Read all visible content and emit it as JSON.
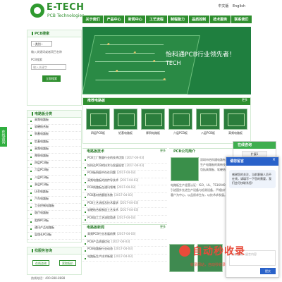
{
  "header": {
    "logo_text": "E-TECH",
    "logo_sub": "PCB Technologies",
    "lang": [
      "中文版",
      "English"
    ]
  },
  "nav": [
    "关于我们",
    "产品中心",
    "新闻中心",
    "工艺流程",
    "制程能力",
    "品质控制",
    "技术服务",
    "联系我们"
  ],
  "banner": {
    "slogan": "怡科通PCB行业领先者！",
    "en": "TECH"
  },
  "search": {
    "title": "PCB搜索",
    "select_value": "--类别--",
    "hint": "输入关键词或者项目名称",
    "label": "PCB搜索",
    "placeholder": "输入关键字",
    "button": "立即搜索"
  },
  "categories": {
    "title": "电路板分类",
    "items": [
      "高频电路板",
      "软硬结合板",
      "铜基电路板",
      "铝基电路板",
      "高频电路板",
      "厚铜电路板",
      "四层PCB板",
      "六层PCB板",
      "八层PCB板",
      "多层PCB板",
      "LED电路板",
      "汽车电路板",
      "工业控制电路板",
      "医疗电路板",
      "阻焊PCB板",
      "通讯产品电路板",
      "盲埋孔PCB板"
    ]
  },
  "contact": {
    "title": "找服务咨询",
    "buttons": [
      "在线咨询",
      "索取报价"
    ],
    "tel": "热线电话：400-888-8888"
  },
  "products": {
    "title": "推荐电路板",
    "more": "更多",
    "items": [
      "四层PCB板",
      "铝基电路板",
      "厚铜电路板",
      "六层PCB板",
      "八层PCB板",
      "高频电路板"
    ]
  },
  "tech_news": {
    "title": "电路板技术",
    "more": "更多",
    "items": [
      {
        "text": "PCB工厂数量行业的技术优势",
        "date": "[2017-04-03]"
      },
      {
        "text": "怡科达PCB的技术与发展现状",
        "date": "[2017-04-03]"
      },
      {
        "text": "PCB板铜面中存在问题",
        "date": "[2017-04-03]"
      },
      {
        "text": "高频电路板的热传导技术",
        "date": "[2017-04-03]"
      },
      {
        "text": "PCB线路板在通讯领域",
        "date": "[2017-04-03]"
      },
      {
        "text": "PCB基材热膨胀系数",
        "date": "[2017-04-03]"
      },
      {
        "text": "PCB工艺流程及技术要求",
        "date": "[2017-04-03]"
      },
      {
        "text": "软硬结合板制造工艺技术",
        "date": "[2017-04-03]"
      },
      {
        "text": "PCB加工工艺流程简述",
        "date": "[2017-04-03]"
      }
    ]
  },
  "industry_news": {
    "title": "电路板新闻",
    "more": "更多",
    "items": [
      {
        "text": "高频PCB行业发展前景",
        "date": "[2017-04-03]"
      },
      {
        "text": "PCB产品质量优化",
        "date": "[2017-04-03]"
      },
      {
        "text": "PCB电路板行业动态",
        "date": "[2017-04-03]"
      },
      {
        "text": "电路板生产技术新规",
        "date": "[2017-04-03]"
      }
    ]
  },
  "intro": {
    "title": "PCB公司简介",
    "more": "更多",
    "side": "深圳市怡科通电路有限公司是一家专业生产电路板的高新技术企业，主要产品包括高频板、软硬结合板。",
    "text": "电路板生产经营认证：ISO、UL、TS16949、ROHS等。公司引进国外先进生产设备与检测设备，严格执行品质管控，坚持以客户为中心，以品质求生存，以技术求发展。"
  },
  "side_tab": "在线咨询",
  "service": {
    "title": "在线咨询",
    "buttons": [
      "扩展1",
      "扩展2",
      "扩展3"
    ]
  },
  "chat": {
    "title": "请您留言",
    "close": "×",
    "message": "感谢您的关注，当前客服人员不在线，请填写一下您的需要，我们会尽快联系您！",
    "placeholder": "请在此输入留言内容",
    "send": "提交"
  },
  "watermark": {
    "text": "自动秒收录",
    "sub": "收录网站，自动秒收录"
  },
  "colors": {
    "brand_green": "#2f8f2f",
    "chat_blue": "#2a62c9",
    "watermark_red": "#e84b3a"
  }
}
